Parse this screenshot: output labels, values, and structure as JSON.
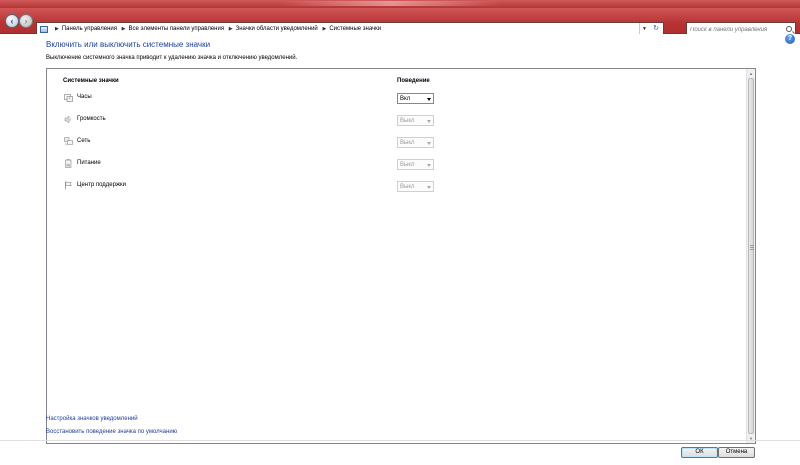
{
  "address_bar": {
    "breadcrumbs": [
      "Панель управления",
      "Все элементы панели управления",
      "Значки области уведомлений",
      "Системные значки"
    ]
  },
  "search": {
    "placeholder": "Поиск в панели управления"
  },
  "main": {
    "title": "Включить или выключить системные значки",
    "description": "Выключение системного значка приводит к удалению значка и отключению уведомлений.",
    "columns": {
      "icons": "Системные значки",
      "behavior": "Поведение"
    },
    "rows": [
      {
        "icon": "clock-icon",
        "label": "Часы",
        "value": "Вкл",
        "enabled": true
      },
      {
        "icon": "volume-icon",
        "label": "Громкость",
        "value": "Выкл",
        "enabled": false
      },
      {
        "icon": "network-icon",
        "label": "Сеть",
        "value": "Выкл",
        "enabled": false
      },
      {
        "icon": "power-icon",
        "label": "Питание",
        "value": "Выкл",
        "enabled": false
      },
      {
        "icon": "action-center-flag-icon",
        "label": "Центр поддержки",
        "value": "Выкл",
        "enabled": false
      }
    ],
    "links": {
      "customize": "Настройка значков уведомлений",
      "restore": "Восстановить поведение значка по умолчанию"
    }
  },
  "footer": {
    "ok_label": "ОК",
    "cancel_label": "Отмена"
  },
  "colors": {
    "title_link": "#1e3f9a",
    "window_frame": "#b83333"
  }
}
